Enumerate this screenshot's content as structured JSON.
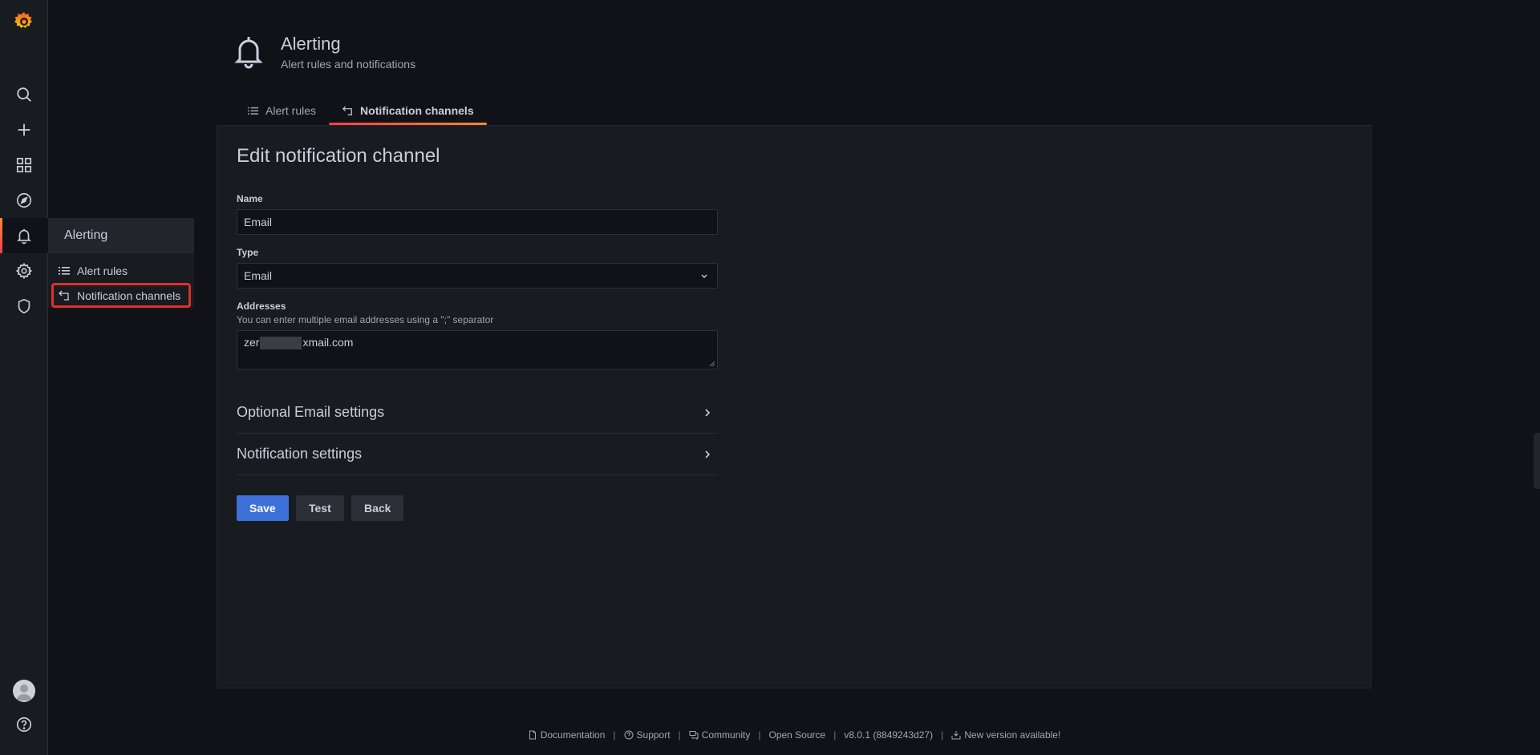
{
  "sidemenu": {
    "logo": "grafana-logo",
    "icons": [
      "search-icon",
      "plus-icon",
      "dashboards-icon",
      "explore-icon",
      "bell-icon",
      "gear-icon",
      "shield-icon"
    ],
    "bottom_icons": [
      "avatar",
      "help-icon"
    ]
  },
  "flyout": {
    "header": "Alerting",
    "items": [
      {
        "label": "Alert rules",
        "icon": "list-icon"
      },
      {
        "label": "Notification channels",
        "icon": "channel-icon"
      }
    ]
  },
  "page_header": {
    "title": "Alerting",
    "subtitle": "Alert rules and notifications"
  },
  "tabs": [
    {
      "label": "Alert rules",
      "icon": "list-icon",
      "active": false
    },
    {
      "label": "Notification channels",
      "icon": "channel-icon",
      "active": true
    }
  ],
  "form": {
    "title": "Edit notification channel",
    "name_label": "Name",
    "name_value": "Email",
    "type_label": "Type",
    "type_value": "Email",
    "addresses_label": "Addresses",
    "addresses_desc": "You can enter multiple email addresses using a \";\" separator",
    "addresses_value_start": "zer",
    "addresses_value_end": "xmail.com",
    "optional_settings": "Optional Email settings",
    "notification_settings": "Notification settings",
    "save": "Save",
    "test": "Test",
    "back": "Back"
  },
  "footer": {
    "documentation": "Documentation",
    "support": "Support",
    "community": "Community",
    "open_source": "Open Source",
    "version": "v8.0.1 (8849243d27)",
    "new_version": "New version available!",
    "separator": "|"
  },
  "colors": {
    "accent_orange": "#ff8833",
    "primary_blue": "#3d71d9",
    "highlight_red": "#e02f2f"
  }
}
